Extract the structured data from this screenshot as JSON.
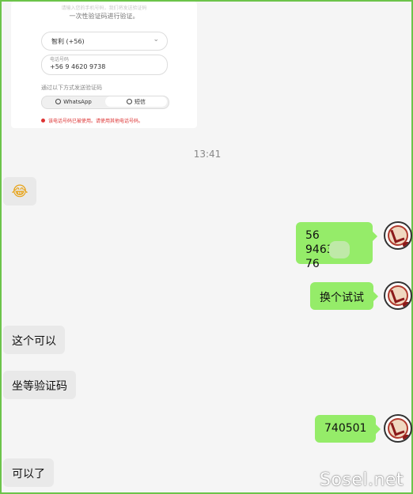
{
  "screenshot": {
    "top_text": "请输入您的手机号码，我们将发送验证码",
    "prompt": "一次性验证码进行验证。",
    "country": "智利 (+56)",
    "phone_caption": "电话号码",
    "phone_value": "+56  9 4620 9738",
    "send_caption": "通过以下方式发送验证码",
    "options": [
      "WhatsApp",
      "短信"
    ],
    "error": "该电话号码已被使用。请使用其他电话号码。"
  },
  "timestamp": "13:41",
  "messages": [
    {
      "side": "left",
      "type": "emoji",
      "icon": "laughing-emoji"
    },
    {
      "side": "right",
      "lines": [
        "56",
        "9463",
        "76"
      ]
    },
    {
      "side": "right",
      "text": "换个试试"
    },
    {
      "side": "left",
      "text": "这个可以"
    },
    {
      "side": "left",
      "text": "坐等验证码"
    },
    {
      "side": "right",
      "text": "740501"
    },
    {
      "side": "left",
      "text": "可以了"
    }
  ],
  "watermark": "Sosel.net",
  "colors": {
    "sent_bubble": "#95ec69",
    "received_bubble": "#e9e9e9",
    "error": "#dd3333",
    "border": "#6cc44a"
  }
}
